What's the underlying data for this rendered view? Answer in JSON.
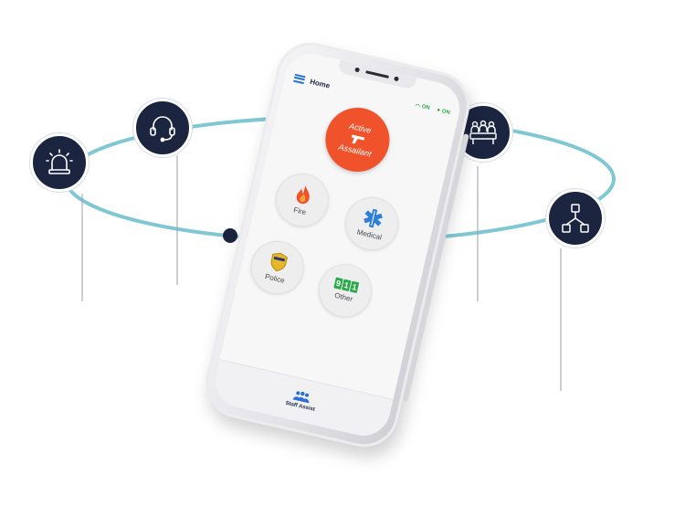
{
  "colors": {
    "ring": "#7fc8d3",
    "node_bg": "#1c2540",
    "accent_orange": "#f0522b",
    "status_green": "#2aa84a",
    "menu_blue": "#2a6fd6"
  },
  "floating_icons": [
    {
      "name": "alarm-light-icon"
    },
    {
      "name": "headset-icon"
    },
    {
      "name": "meeting-room-icon"
    },
    {
      "name": "org-chart-icon"
    }
  ],
  "app": {
    "title": "Home",
    "status": [
      {
        "icon": "wifi-icon",
        "label": "ON"
      },
      {
        "icon": "location-pin-icon",
        "label": "ON"
      }
    ],
    "active_assailant": {
      "line1": "Active",
      "line2": "Assailant"
    },
    "buttons": {
      "fire": "Fire",
      "medical": "Medical",
      "police": "Police",
      "other": "Other",
      "other_badge": [
        "9",
        "1",
        "1"
      ]
    },
    "bottom": {
      "label": "Staff Assist"
    }
  }
}
